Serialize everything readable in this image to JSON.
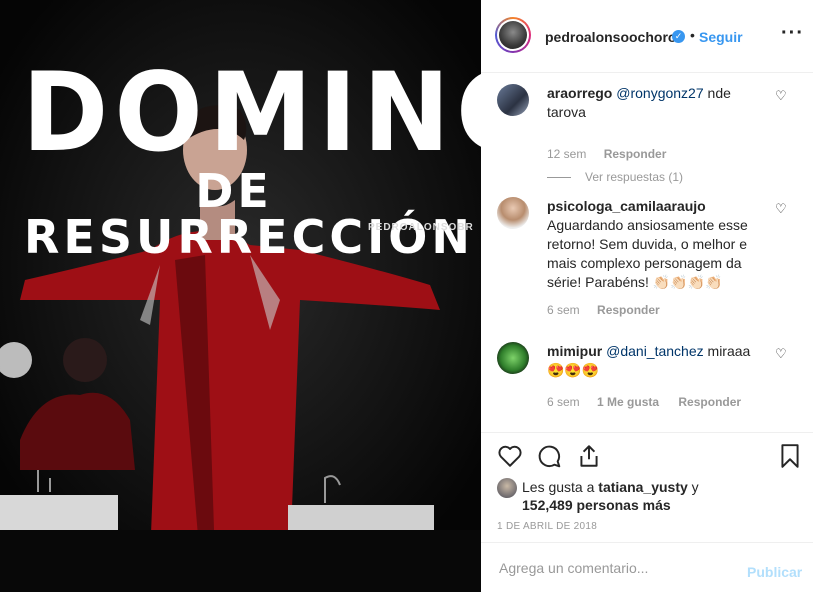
{
  "post": {
    "image_text": {
      "line1": "DOMINGO",
      "line2": "DE RESURRECCIÓN",
      "watermark": "PEDROALONSOBR"
    }
  },
  "header": {
    "username": "pedroalonsoochoro",
    "follow_label": "Seguir",
    "separator": "•",
    "more_icon": "more-horizontal-icon"
  },
  "comments": [
    {
      "username": "araorrego",
      "mention": "@ronygonz27",
      "text": " nde tarova",
      "time": "12 sem",
      "reply_label": "Responder",
      "view_replies": "Ver respuestas (1)"
    },
    {
      "username": "psicologa_camilaaraujo",
      "text": " Aguardando ansiosamente esse retorno! Sem duvida, o melhor e mais complexo personagem da série! Parabéns! 👏🏻👏🏻👏🏻👏🏻",
      "time": "6 sem",
      "reply_label": "Responder"
    },
    {
      "username": "mimipur",
      "mention": "@dani_tanchez",
      "text": " miraaa 😍😍😍",
      "time": "6 sem",
      "likes_label": "1 Me gusta",
      "reply_label": "Responder"
    }
  ],
  "likes": {
    "prefix": "Les gusta a ",
    "user": "tatiana_yusty",
    "mid": " y ",
    "count": "152,489 personas más"
  },
  "date": "1 DE ABRIL DE 2018",
  "add_comment": {
    "placeholder": "Agrega un comentario...",
    "publish_label": "Publicar"
  },
  "colors": {
    "accent": "#3897f0",
    "publish_disabled": "#b2dffc",
    "mention": "#003569",
    "muted": "#999999"
  }
}
